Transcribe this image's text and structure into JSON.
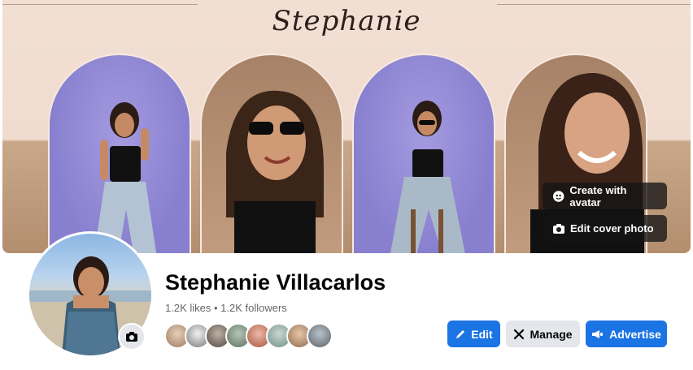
{
  "cover": {
    "script_title": "Stephanie",
    "buttons": {
      "create_avatar": "Create with avatar",
      "edit_cover": "Edit cover photo"
    }
  },
  "profile": {
    "name": "Stephanie Villacarlos",
    "stats": "1.2K likes • 1.2K followers"
  },
  "actions": {
    "edit": "Edit",
    "manage": "Manage",
    "advertise": "Advertise"
  },
  "colors": {
    "primary": "#1b74e4",
    "secondary": "#e4e6eb",
    "cover_bg": "#f2dfd3"
  },
  "icons": [
    "pencil-icon",
    "manage-icon",
    "megaphone-icon",
    "camera-icon",
    "avatar-face-icon"
  ],
  "friend_avatars_count_shown": 8
}
